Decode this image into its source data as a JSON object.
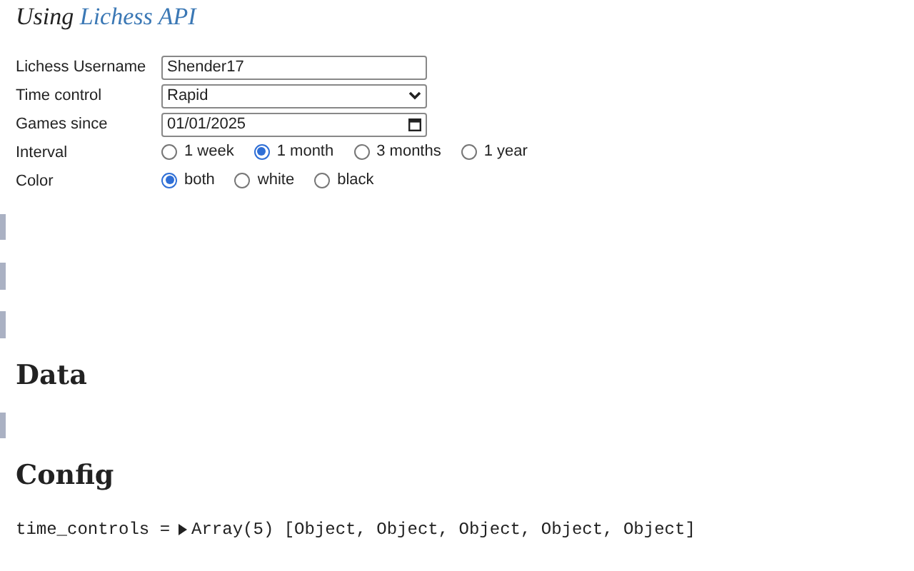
{
  "subtitle": {
    "prefix": "Using",
    "link": "Lichess API"
  },
  "form": {
    "username": {
      "label": "Lichess Username",
      "value": "Shender17"
    },
    "time_control": {
      "label": "Time control",
      "value": "Rapid"
    },
    "games_since": {
      "label": "Games since",
      "value": "01/01/2025"
    },
    "interval": {
      "label": "Interval",
      "options": [
        {
          "label": "1 week",
          "selected": false
        },
        {
          "label": "1 month",
          "selected": true
        },
        {
          "label": "3 months",
          "selected": false
        },
        {
          "label": "1 year",
          "selected": false
        }
      ]
    },
    "color": {
      "label": "Color",
      "options": [
        {
          "label": "both",
          "selected": true
        },
        {
          "label": "white",
          "selected": false
        },
        {
          "label": "black",
          "selected": false
        }
      ]
    }
  },
  "headings": [
    "Data",
    "Config"
  ],
  "config_line": {
    "name": "time_controls =",
    "value": "Array(5) [Object, Object, Object, Object, Object]"
  }
}
